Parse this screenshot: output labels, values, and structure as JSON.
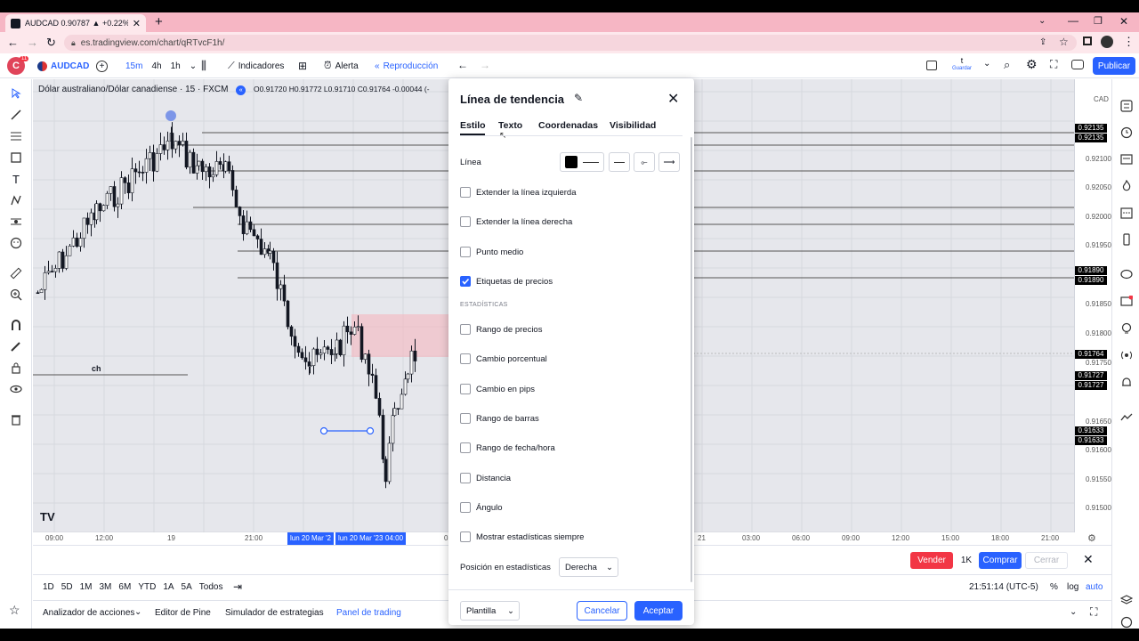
{
  "browser": {
    "tab_title": "AUDCAD 0.90787 ▲ +0.22% t",
    "url": "es.tradingview.com/chart/qRTvcF1h/"
  },
  "toolbar": {
    "avatar_letter": "C",
    "notif_count": "11",
    "symbol": "AUDCAD",
    "intervals": [
      "15m",
      "4h",
      "1h"
    ],
    "indicators_label": "Indicadores",
    "alert_label": "Alerta",
    "replay_label": "Reproducción",
    "save_top": "t",
    "save_bottom": "Guardar",
    "publish_label": "Publicar"
  },
  "chart": {
    "title": "Dólar australiano/Dólar canadiense · 15 · FXCM",
    "ohlc": "O0.91720 H0.91772 L0.91710 C0.91764 -0.00044 (-",
    "currency": "CAD",
    "annotation": "ch",
    "price_labels": [
      "0.92100",
      "0.92050",
      "0.92000",
      "0.91950",
      "0.91850",
      "0.91800",
      "0.91750",
      "0.91650",
      "0.91600",
      "0.91550",
      "0.91500"
    ],
    "price_badges": [
      "0.92135",
      "0.92135",
      "0.91890",
      "0.91890",
      "0.91764",
      "0.91727",
      "0.91727",
      "0.91633",
      "0.91633"
    ],
    "time_labels": [
      "09:00",
      "12:00",
      "19",
      "21:00",
      "0",
      "21",
      "03:00",
      "06:00",
      "09:00",
      "12:00",
      "15:00",
      "18:00",
      "21:00"
    ],
    "time_highlight_1": "lun 20 Mar '2",
    "time_highlight_2": "lun 20 Mar '23",
    "time_highlight_3": "04:00"
  },
  "orderbar": {
    "sell": "Vender",
    "qty": "1K",
    "buy": "Comprar",
    "close": "Cerrar"
  },
  "rangebar": {
    "ranges": [
      "1D",
      "5D",
      "1M",
      "3M",
      "6M",
      "YTD",
      "1A",
      "5A",
      "Todos"
    ],
    "clock": "21:51:14 (UTC-5)",
    "pct": "%",
    "log": "log",
    "auto": "auto"
  },
  "bottomtabs": {
    "tabs": [
      "Analizador de acciones",
      "Editor de Pine",
      "Simulador de estrategias",
      "Panel de trading"
    ]
  },
  "dialog": {
    "title": "Línea de tendencia",
    "tabs": [
      "Estilo",
      "Texto",
      "Coordenadas",
      "Visibilidad"
    ],
    "line_label": "Línea",
    "options": [
      {
        "label": "Extender la línea izquierda",
        "checked": false
      },
      {
        "label": "Extender la línea derecha",
        "checked": false
      },
      {
        "label": "Punto medio",
        "checked": false
      },
      {
        "label": "Etiquetas de precios",
        "checked": true
      }
    ],
    "stats_heading": "ESTADÍSTICAS",
    "stats": [
      {
        "label": "Rango de precios",
        "checked": false
      },
      {
        "label": "Cambio porcentual",
        "checked": false
      },
      {
        "label": "Cambio en pips",
        "checked": false
      },
      {
        "label": "Rango de barras",
        "checked": false
      },
      {
        "label": "Rango de fecha/hora",
        "checked": false
      },
      {
        "label": "Distancia",
        "checked": false
      },
      {
        "label": "Ángulo",
        "checked": false
      },
      {
        "label": "Mostrar estadísticas siempre",
        "checked": false
      }
    ],
    "position_label": "Posición en estadísticas",
    "position_value": "Derecha",
    "template_label": "Plantilla",
    "cancel_label": "Cancelar",
    "accept_label": "Aceptar"
  },
  "colors": {
    "accent": "#2962ff",
    "sell": "#f23645",
    "tab_bg": "#f6b6c4"
  }
}
